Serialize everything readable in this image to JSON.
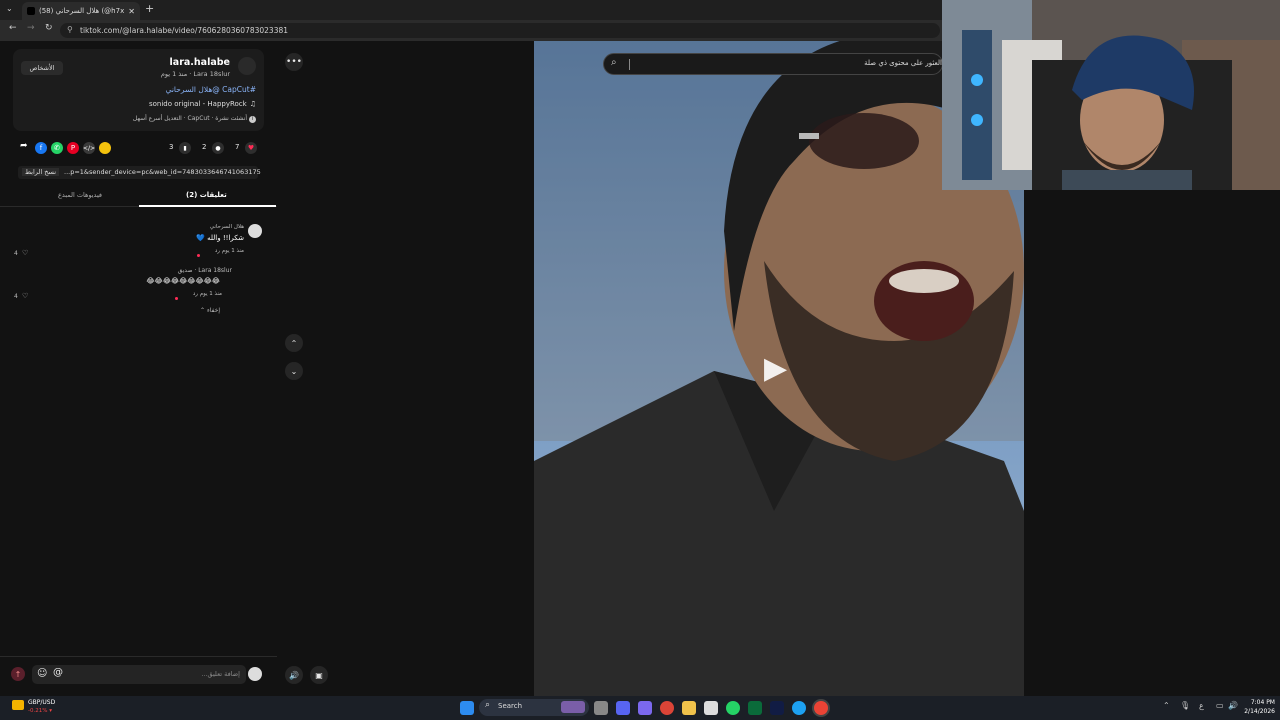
{
  "browser": {
    "tab_title": "(58) هلال السرحاني (@h7xs5) | ...",
    "new_tab_symbol": "+",
    "url": "tiktok.com/@lara.halabe/video/7606280360783023381"
  },
  "post": {
    "username": "lara.halabe",
    "subline": "Lara 18slur · منذ 1 يوم",
    "follow_label": "الأشخاص",
    "caption": "#CapCut @هلال السرحاني",
    "sound": "sonido original - HappyRock",
    "capcut_note": "أنشئت نشرة · CapCut · التعديل أسرع أسهل",
    "likes": "7",
    "comments": "2",
    "saves": "3",
    "link": "...p=1&sender_device=pc&web_id=7483033646741063175",
    "copy_link_label": "نسخ الرابط"
  },
  "tabs": {
    "comments": "تعليقات (2)",
    "creator_videos": "فيديوهات المبدع"
  },
  "comments": [
    {
      "author": "هلال السرحاني",
      "text": "شكرا!! والله 💙",
      "meta": "منذ 1 يوم   رد",
      "likes": "4"
    },
    {
      "author": "Lara 18slur · صديق",
      "text": "😂😂😂😂😂😂😂😂😂",
      "meta": "منذ 1 يوم   رد",
      "likes": "4"
    }
  ],
  "hide_replies_label": "إخفاء",
  "comment_input_placeholder": "إضافة تعليق...",
  "search": {
    "placeholder": "العثور على محتوى ذي صلة"
  },
  "taskbar": {
    "widget_title": "GBP/USD",
    "widget_value": "-0.21% ▾",
    "search_label": "Search",
    "time": "7:04 PM",
    "date": "2/14/2026"
  },
  "colors": {
    "like_red": "#fe2c55",
    "accent_link": "#8ab4f8",
    "facebook": "#1877f2",
    "whatsapp": "#25d366",
    "pinterest": "#e60023"
  }
}
